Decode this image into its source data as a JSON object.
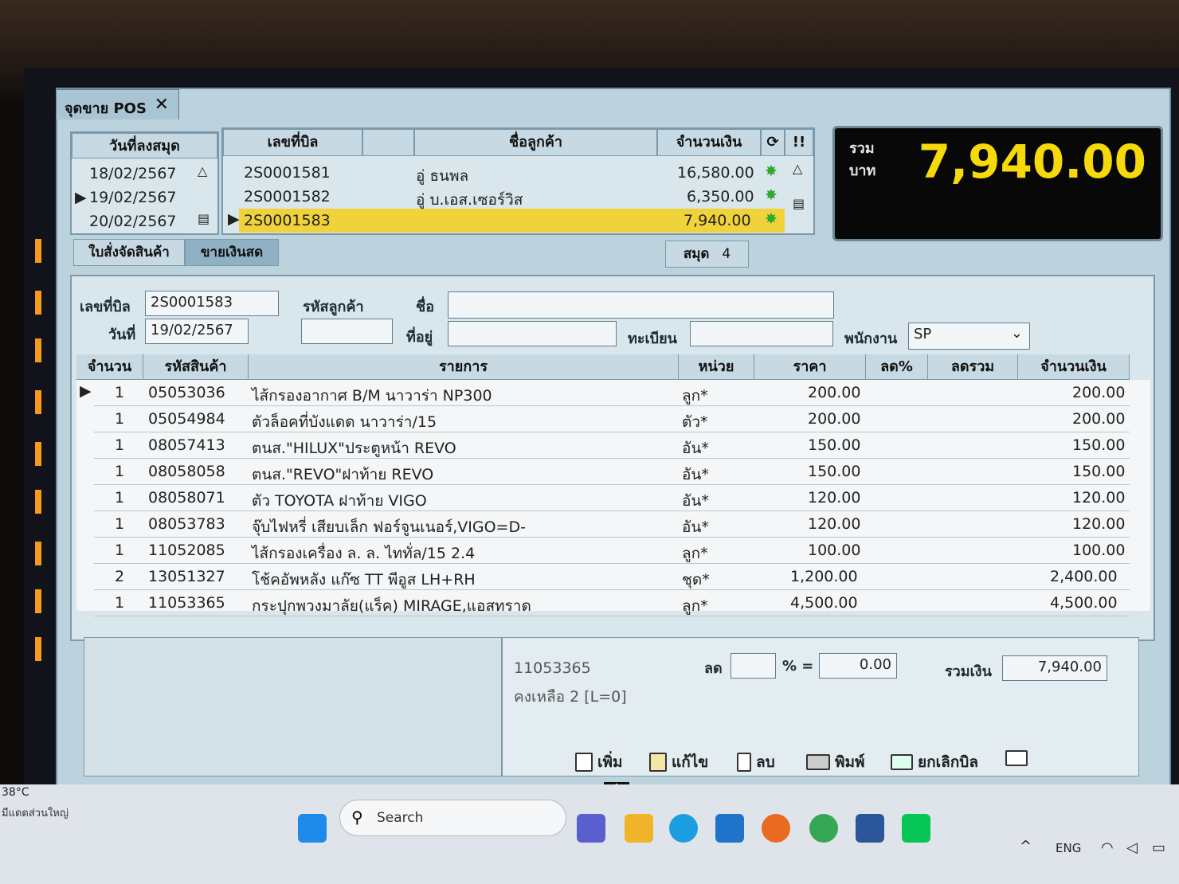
{
  "window": {
    "tab_title": "จุดขาย POS",
    "close_label": "✕"
  },
  "date_list": {
    "header": "วันที่ลงสมุด",
    "dates": [
      "18/02/2567",
      "19/02/2567",
      "20/02/2567"
    ]
  },
  "bill_list": {
    "headers": {
      "bill_no": "เลขที่บิล",
      "customer": "ชื่อลูกค้า",
      "amount": "จำนวนเงิน",
      "alert": "!!"
    },
    "rows": [
      {
        "bill_no": "2S0001581",
        "customer": "อู่ ธนพล",
        "amount": "16,580.00"
      },
      {
        "bill_no": "2S0001582",
        "customer": "อู่ บ.เอส.เซอร์วิส",
        "amount": "6,350.00"
      },
      {
        "bill_no": "2S0001583",
        "customer": "",
        "amount": "7,940.00"
      }
    ]
  },
  "tabs": {
    "order": "ใบสั่งจัดสินค้า",
    "cash": "ขายเงินสด"
  },
  "book": {
    "label": "สมุด",
    "value": "4"
  },
  "total": {
    "label_line1": "รวม",
    "label_line2": "บาท",
    "value": "7,940.00"
  },
  "form": {
    "bill_no_label": "เลขที่บิล",
    "bill_no": "2S0001583",
    "date_label": "วันที่",
    "date": "19/02/2567",
    "customer_code_label": "รหัสลูกค้า",
    "customer_code": "",
    "name_label": "ชื่อ",
    "name": "",
    "address_label": "ที่อยู่",
    "address": "",
    "register_label": "ทะเบียน",
    "register": "",
    "employee_label": "พนักงาน",
    "employee": "SP"
  },
  "grid": {
    "headers": {
      "qty": "จำนวน",
      "code": "รหัสสินค้า",
      "desc": "รายการ",
      "unit": "หน่วย",
      "price": "ราคา",
      "disc_pct": "ลด%",
      "disc_total": "ลดรวม",
      "amount": "จำนวนเงิน"
    },
    "rows": [
      {
        "qty": "1",
        "code": "05053036",
        "desc": "ไส้กรองอากาศ B/M นาวาร่า NP300",
        "unit": "ลูก*",
        "price": "200.00",
        "amount": "200.00"
      },
      {
        "qty": "1",
        "code": "05054984",
        "desc": "ตัวล็อคที่บังแดด นาวาร่า/15",
        "unit": "ตัว*",
        "price": "200.00",
        "amount": "200.00"
      },
      {
        "qty": "1",
        "code": "08057413",
        "desc": "ตนส.\"HILUX\"ประตูหน้า REVO",
        "unit": "อัน*",
        "price": "150.00",
        "amount": "150.00"
      },
      {
        "qty": "1",
        "code": "08058058",
        "desc": "ตนส.\"REVO\"ฝาท้าย REVO",
        "unit": "อัน*",
        "price": "150.00",
        "amount": "150.00"
      },
      {
        "qty": "1",
        "code": "08058071",
        "desc": "ตัว TOYOTA ฝาท้าย VIGO",
        "unit": "อัน*",
        "price": "120.00",
        "amount": "120.00"
      },
      {
        "qty": "1",
        "code": "08053783",
        "desc": "จุ๊บไฟหรี่ เสียบเล็ก ฟอร์จูนเนอร์,VIGO=D-",
        "unit": "อัน*",
        "price": "120.00",
        "amount": "120.00"
      },
      {
        "qty": "1",
        "code": "11052085",
        "desc": "ไส้กรองเครื่อง ล. ล. ไททั่ล/15 2.4",
        "unit": "ลูก*",
        "price": "100.00",
        "amount": "100.00"
      },
      {
        "qty": "2",
        "code": "13051327",
        "desc": "โช้คอัพหลัง แก๊ซ TT พีอูส LH+RH",
        "unit": "ชุด*",
        "price": "1,200.00",
        "amount": "2,400.00"
      },
      {
        "qty": "1",
        "code": "11053365",
        "desc": "กระปุกพวงมาลัย(แร็ค) MIRAGE,แอสทราด",
        "unit": "ลูก*",
        "price": "4,500.00",
        "amount": "4,500.00"
      }
    ]
  },
  "footer": {
    "selected_code": "11053365",
    "remaining": "คงเหลือ 2 [L=0]",
    "discount_label": "ลด",
    "discount_pct": "",
    "pct_sign": "% =",
    "discount_value": "0.00",
    "sum_label": "รวมเงิน",
    "sum_value": "7,940.00"
  },
  "actions": {
    "add": "เพิ่ม",
    "edit": "แก้ไข",
    "delete": "ลบ",
    "print": "พิมพ์",
    "cancel": "ยกเลิกบิล"
  },
  "taskbar": {
    "weather_temp": "38°C",
    "weather_desc": "มีแดดส่วนใหญ่",
    "search": "Search",
    "lang": "ENG"
  }
}
